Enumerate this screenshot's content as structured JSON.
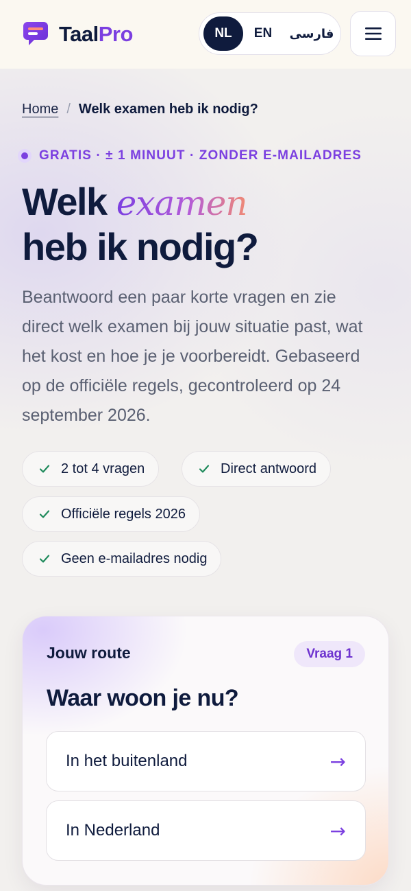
{
  "brand": {
    "name_part1": "Taal",
    "name_part2": "Pro",
    "color": "#7b3fe0"
  },
  "language_switch": {
    "options": [
      "NL",
      "EN",
      "فارسی"
    ],
    "active": "NL"
  },
  "menu": {
    "icon": "hamburger-menu-icon"
  },
  "breadcrumb": {
    "home": "Home",
    "separator": "/",
    "current": "Welk examen heb ik nodig?"
  },
  "eyebrow": "GRATIS · ± 1 MINUUT · ZONDER E-MAILADRES",
  "title": {
    "line1_prefix": "Welk",
    "line1_accent": "examen",
    "line2": "heb ik nodig?"
  },
  "lead": "Beantwoord een paar korte vragen en zie direct welk examen bij jouw situatie past, wat het kost en hoe je je voorbereidt. Gebaseerd op de officiële regels, gecontroleerd op 24 september 2026.",
  "chips": [
    "2 tot 4 vragen",
    "Direct antwoord",
    "Officiële regels 2026",
    "Geen e-mailadres nodig"
  ],
  "route_card": {
    "label": "Jouw route",
    "badge": "Vraag 1",
    "question": "Waar woon je nu?",
    "options": [
      {
        "label": "In het buitenland",
        "arrow": "→"
      },
      {
        "label": "In Nederland",
        "arrow": "→"
      }
    ]
  },
  "colors": {
    "navy": "#0f1b3d",
    "purple": "#7b3fe0",
    "check_green": "#1f8a5b"
  }
}
